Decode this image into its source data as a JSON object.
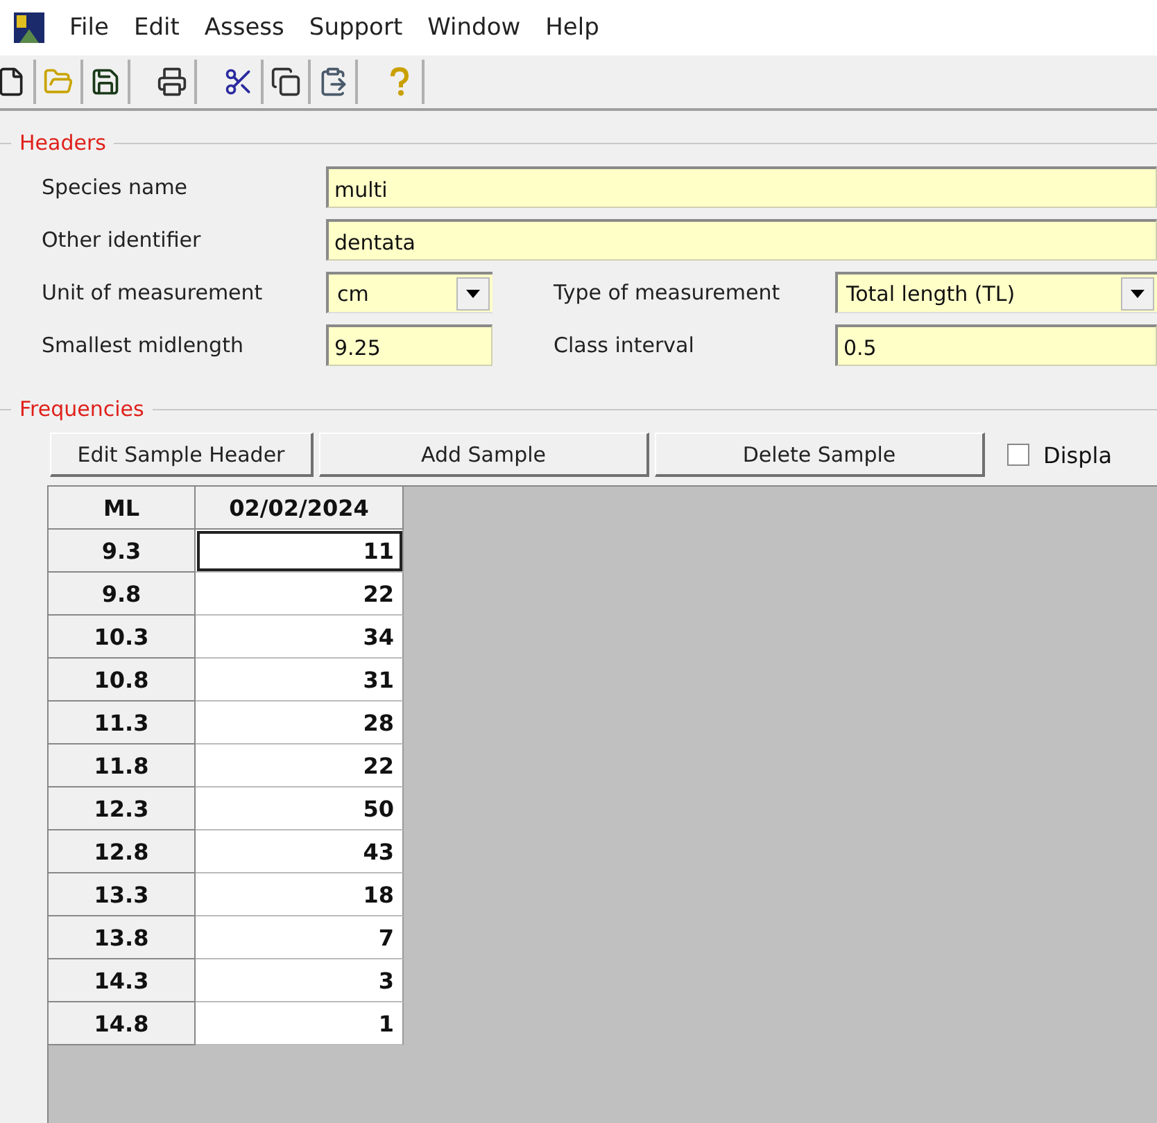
{
  "menu": [
    "File",
    "Edit",
    "Assess",
    "Support",
    "Window",
    "Help"
  ],
  "toolbar": [
    {
      "kind": "new"
    },
    {
      "kind": "open"
    },
    {
      "kind": "save"
    },
    {
      "kind": "print",
      "gap": true
    },
    {
      "kind": "cut",
      "gap": true
    },
    {
      "kind": "copy"
    },
    {
      "kind": "paste"
    },
    {
      "kind": "help",
      "gap": true
    }
  ],
  "headers": {
    "title": "Headers",
    "species_name": {
      "label": "Species name",
      "value": "multi"
    },
    "other_identifier": {
      "label": "Other identifier",
      "value": "dentata"
    },
    "unit": {
      "label": "Unit of measurement",
      "value": "cm"
    },
    "type": {
      "label": "Type of measurement",
      "value": "Total length (TL)"
    },
    "smallest_midlength": {
      "label": "Smallest midlength",
      "value": "9.25"
    },
    "class_interval": {
      "label": "Class interval",
      "value": "0.5"
    }
  },
  "frequencies": {
    "title": "Frequencies",
    "buttons": [
      "Edit Sample Header",
      "Add Sample",
      "Delete Sample"
    ],
    "checkbox": {
      "label": "Displa",
      "checked": false
    },
    "table": {
      "columns": [
        "ML",
        "02/02/2024"
      ],
      "rows": [
        {
          "ml": "9.3",
          "value": "11",
          "selected": true
        },
        {
          "ml": "9.8",
          "value": "22",
          "selected": false
        },
        {
          "ml": "10.3",
          "value": "34",
          "selected": false
        },
        {
          "ml": "10.8",
          "value": "31",
          "selected": false
        },
        {
          "ml": "11.3",
          "value": "28",
          "selected": false
        },
        {
          "ml": "11.8",
          "value": "22",
          "selected": false
        },
        {
          "ml": "12.3",
          "value": "50",
          "selected": false
        },
        {
          "ml": "12.8",
          "value": "43",
          "selected": false
        },
        {
          "ml": "13.3",
          "value": "18",
          "selected": false
        },
        {
          "ml": "13.8",
          "value": "7",
          "selected": false
        },
        {
          "ml": "14.3",
          "value": "3",
          "selected": false
        },
        {
          "ml": "14.8",
          "value": "1",
          "selected": false
        }
      ]
    }
  }
}
